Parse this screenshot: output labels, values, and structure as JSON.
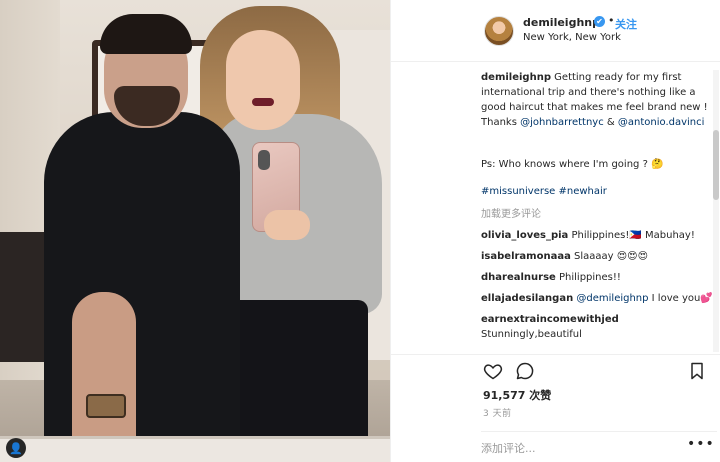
{
  "post": {
    "username": "demileighnp",
    "verified_mark": "✔",
    "separator": "•",
    "follow_label": "关注",
    "location": "New York, New York"
  },
  "caption": {
    "username": "demileighnp",
    "text_1": " Getting ready for my first international trip and there's nothing like a good haircut that makes me feel brand new ! Thanks ",
    "mention_1": "@johnbarrettnyc",
    "text_2": " & ",
    "mention_2": "@antonio.davinci",
    "emoji_1": " 🏻",
    "ps": "Ps: Who knows where I'm going ? 🤔",
    "hashtags": "#missuniverse #newhair"
  },
  "load_more_label": "加载更多评论",
  "comments": [
    {
      "user": "olivia_loves_pia",
      "text": " Philippines!🇵🇭 Mabuhay!"
    },
    {
      "user": "isabelramonaaa",
      "text": " Slaaaay 😍😍😍"
    },
    {
      "user": "dharealnurse",
      "text": " Philippines!!"
    },
    {
      "user": "ellajadesilangan",
      "mention": "@demileighnp",
      "text": " I love you💕"
    },
    {
      "user": "earnextraincomewithjed",
      "text": " Stunningly,beautiful"
    }
  ],
  "likes": "91,577 次赞",
  "time": "3 天前",
  "add_comment_placeholder": "添加评论...",
  "more_label": "•••",
  "user_tag_icon": "👤",
  "icons": {
    "like": "heart-icon",
    "comment": "comment-icon",
    "save": "bookmark-icon",
    "tag": "person-icon"
  },
  "colors": {
    "link": "#003569",
    "accent": "#3897f0",
    "muted": "#999999",
    "text": "#262626"
  }
}
